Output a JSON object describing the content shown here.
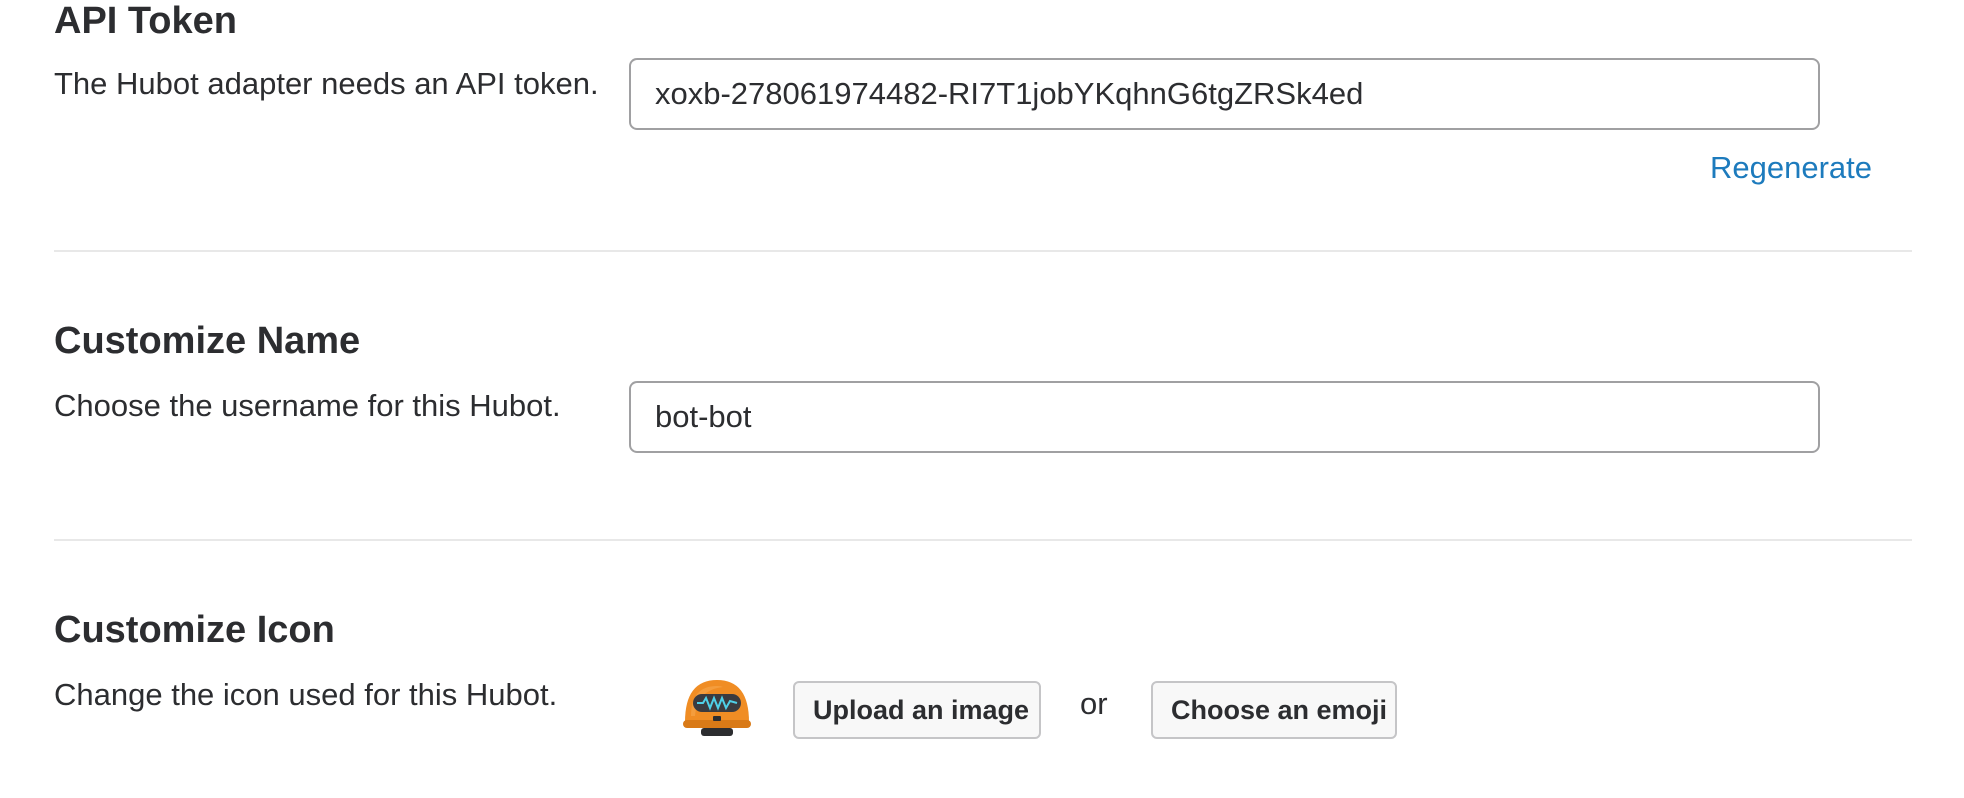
{
  "api_token": {
    "title": "API Token",
    "description": "The Hubot adapter needs an API token.",
    "value": "xoxb-278061974482-RI7T1jobYKqhnG6tgZRSk4ed",
    "regenerate_label": "Regenerate"
  },
  "customize_name": {
    "title": "Customize Name",
    "description": "Choose the username for this Hubot.",
    "value": "bot-bot"
  },
  "customize_icon": {
    "title": "Customize Icon",
    "description": "Change the icon used for this Hubot.",
    "icon": "hubot-avatar-icon",
    "upload_label": "Upload an image",
    "or_label": "or",
    "emoji_label": "Choose an emoji"
  },
  "colors": {
    "link": "#1d7bbd",
    "text": "#2c2d30",
    "avatar_orange": "#f08d24"
  }
}
